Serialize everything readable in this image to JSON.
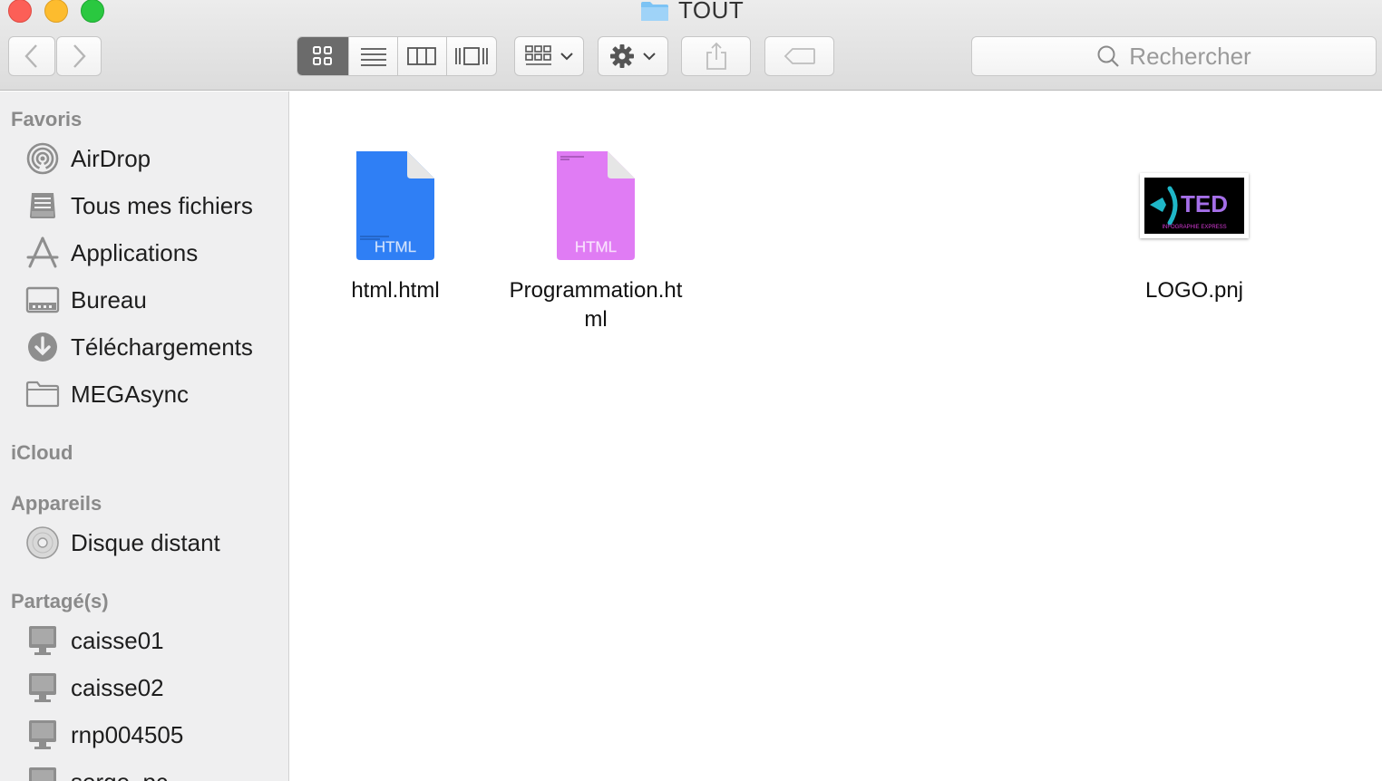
{
  "window": {
    "title": "TOUT"
  },
  "toolbar": {
    "back_label": "Back",
    "forward_label": "Forward"
  },
  "search": {
    "placeholder": "Rechercher"
  },
  "sidebar": {
    "sections": [
      {
        "header": "Favoris",
        "items": [
          {
            "label": "AirDrop",
            "icon": "airdrop-icon"
          },
          {
            "label": "Tous mes fichiers",
            "icon": "all-files-icon"
          },
          {
            "label": "Applications",
            "icon": "applications-icon"
          },
          {
            "label": "Bureau",
            "icon": "desktop-icon"
          },
          {
            "label": "Téléchargements",
            "icon": "downloads-icon"
          },
          {
            "label": "MEGAsync",
            "icon": "folder-icon"
          }
        ]
      },
      {
        "header": "iCloud",
        "items": []
      },
      {
        "header": "Appareils",
        "items": [
          {
            "label": "Disque distant",
            "icon": "disc-icon"
          }
        ]
      },
      {
        "header": "Partagé(s)",
        "items": [
          {
            "label": "caisse01",
            "icon": "computer-icon"
          },
          {
            "label": "caisse02",
            "icon": "computer-icon"
          },
          {
            "label": "rnp004505",
            "icon": "computer-icon"
          },
          {
            "label": "serge_pc",
            "icon": "computer-icon"
          }
        ]
      }
    ]
  },
  "files": [
    {
      "name_line1": "html.html",
      "name_line2": "",
      "badge": "HTML",
      "color": "#2f7ff5"
    },
    {
      "name_line1": "Programmation.ht",
      "name_line2": "ml",
      "badge": "HTML",
      "color": "#e07cf4"
    },
    {
      "name_line1": "LOGO.pnj",
      "name_line2": "",
      "logo_text": "TED",
      "logo_subtext": "INFOGRAPHIE EXPRESS"
    }
  ],
  "colors": {
    "accent": "#2f7ff5",
    "window_bg": "#ececec",
    "sidebar_bg": "#efeff0"
  }
}
